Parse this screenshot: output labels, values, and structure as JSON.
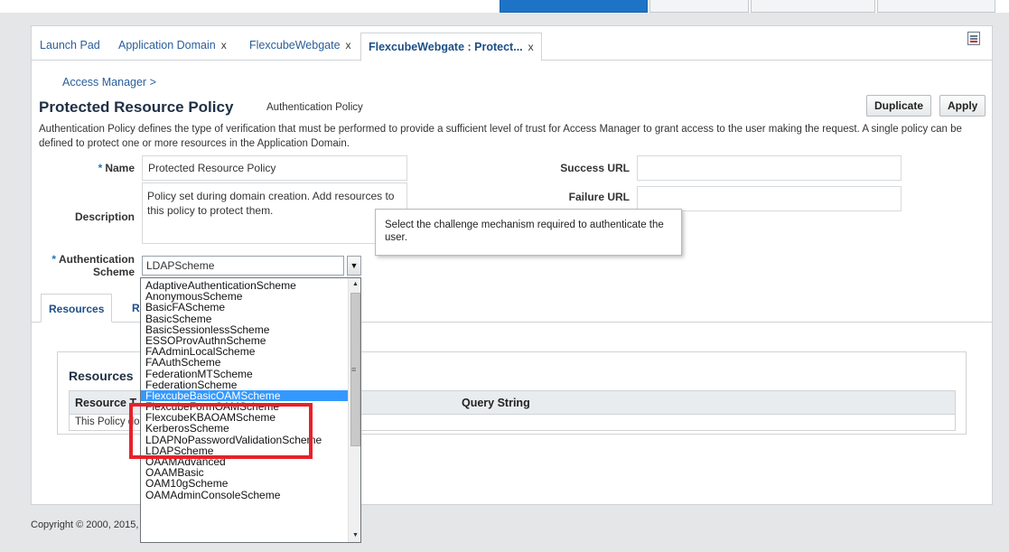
{
  "tabs": [
    {
      "label": "Launch Pad",
      "closable": false
    },
    {
      "label": "Application Domain",
      "closable": true
    },
    {
      "label": "FlexcubeWebgate",
      "closable": true
    },
    {
      "label": "FlexcubeWebgate : Protect...",
      "closable": true,
      "active": true
    }
  ],
  "close_glyph": "x",
  "breadcrumb": "Access Manager >",
  "page": {
    "title": "Protected Resource Policy",
    "subtitle": "Authentication Policy",
    "description": "Authentication Policy defines the type of verification that must be performed to provide a sufficient level of trust for Access Manager to grant access to the user making the request. A single policy can be defined to protect one or more resources in the Application Domain."
  },
  "buttons": {
    "duplicate": "Duplicate",
    "apply": "Apply"
  },
  "form": {
    "required_marker": "*",
    "name_label": "Name",
    "name_value": "Protected Resource Policy",
    "description_label": "Description",
    "description_value": "Policy set during domain creation. Add resources to this policy to protect them.",
    "auth_scheme_label_1": "Authentication",
    "auth_scheme_label_2": "Scheme",
    "auth_scheme_value": "LDAPScheme",
    "success_url_label": "Success URL",
    "success_url_value": "",
    "failure_url_label": "Failure URL",
    "failure_url_value": ""
  },
  "tooltip": "Select the challenge mechanism required to authenticate the user.",
  "subtabs": {
    "resources": "Resources",
    "responses_partial": "Re"
  },
  "resources_panel": {
    "title": "Resources",
    "columns": [
      "Resource T",
      "Query String"
    ],
    "empty_row": "This Policy do"
  },
  "dropdown": {
    "options": [
      "AdaptiveAuthenticationScheme",
      "AnonymousScheme",
      "BasicFAScheme",
      "BasicScheme",
      "BasicSessionlessScheme",
      "ESSOProvAuthnScheme",
      "FAAdminLocalScheme",
      "FAAuthScheme",
      "FederationMTScheme",
      "FederationScheme",
      "FlexcubeBasicOAMScheme",
      "FlexcubeFormOAMScheme",
      "FlexcubeKBAOAMScheme",
      "KerberosScheme",
      "LDAPNoPasswordValidationScheme",
      "LDAPScheme",
      "OAAMAdvanced",
      "OAAMBasic",
      "OAM10gScheme",
      "OAMAdminConsoleScheme"
    ],
    "highlighted_option": "FlexcubeBasicOAMScheme",
    "annotated_options": [
      "FlexcubeBasicOAMScheme",
      "FlexcubeFormOAMScheme",
      "FlexcubeKBAOAMScheme"
    ]
  },
  "footer": "Copyright © 2000, 2015,",
  "colors": {
    "accent": "#1d74c6",
    "link": "#2a5e9c",
    "selection": "#3399ff",
    "annotation": "#e8212b"
  }
}
